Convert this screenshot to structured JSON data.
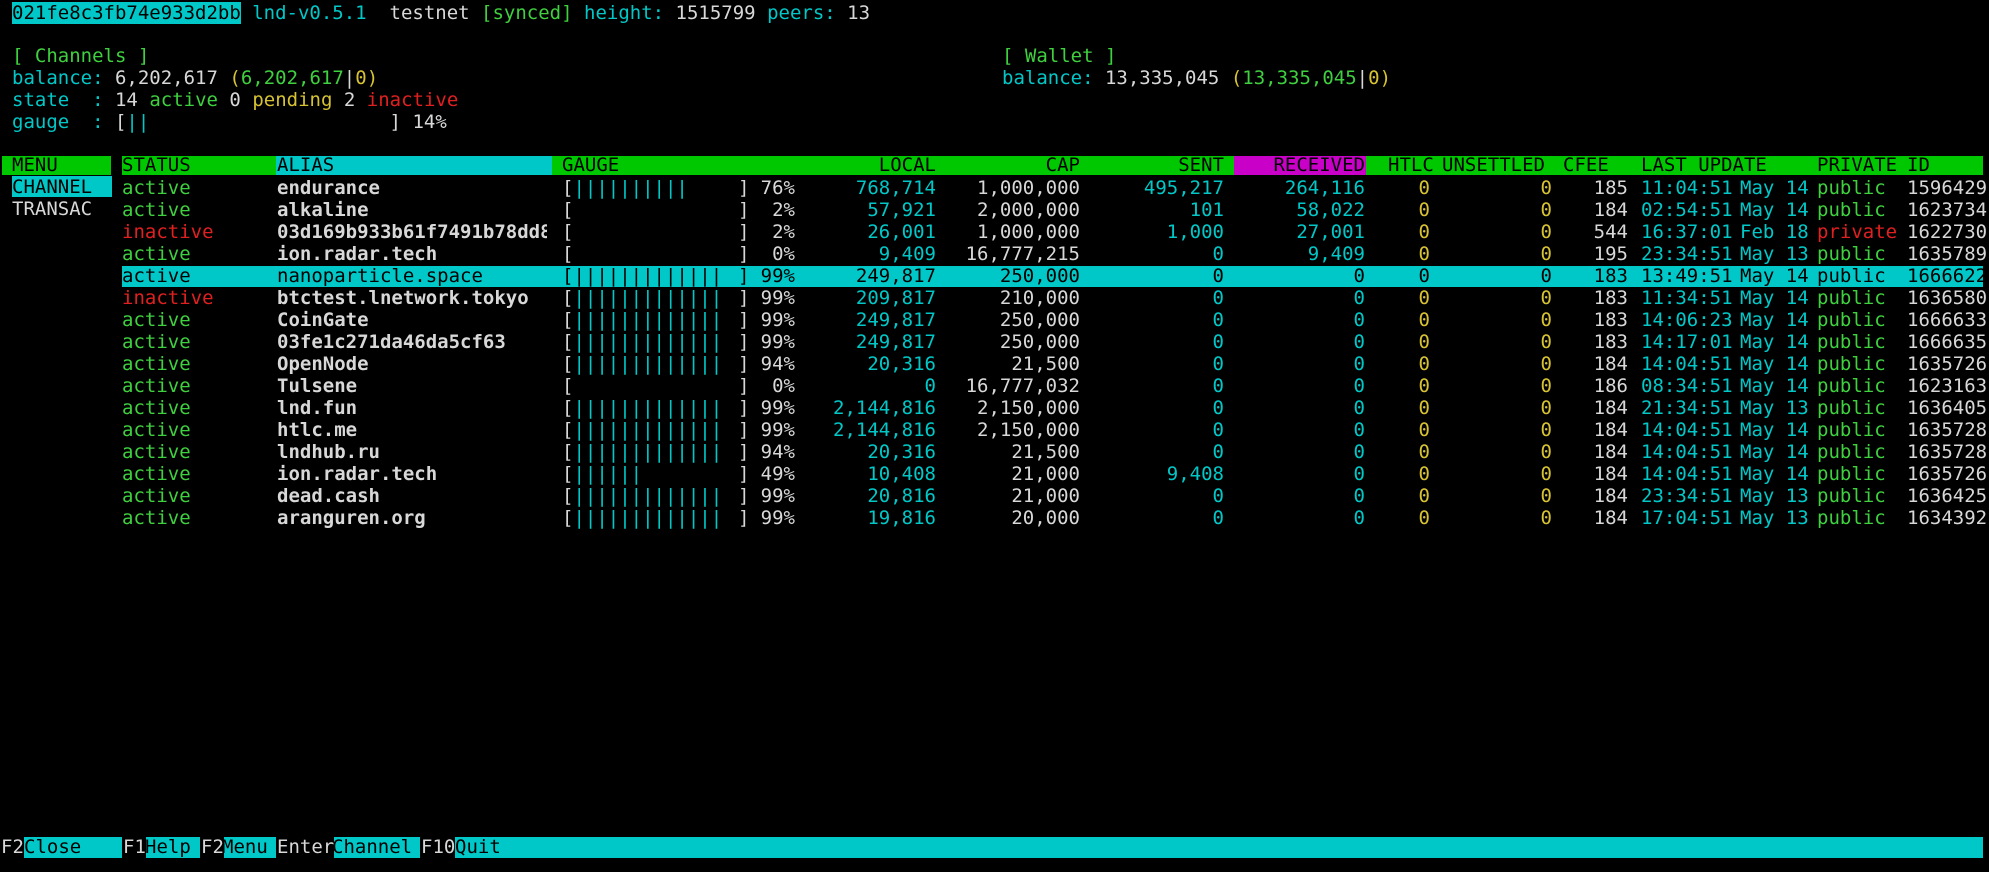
{
  "topbar": {
    "node_id": "021fe8c3fb74e933d2bb",
    "version": "lnd-v0.5.1",
    "network": "testnet",
    "sync_status": "[synced]",
    "height_label": "height:",
    "height": "1515799",
    "peers_label": "peers:",
    "peers": "13"
  },
  "channels_summary": {
    "title": "[ Channels ]",
    "balance_label": "balance:",
    "balance": "6,202,617",
    "balance_local": "6,202,617",
    "balance_remote": "0",
    "state_label": "state  :",
    "active_count": "14",
    "active_label": "active",
    "pending_count": "0",
    "pending_label": "pending",
    "inactive_count": "2",
    "inactive_label": "inactive",
    "gauge_label": "gauge  :",
    "gauge_fill": "||",
    "gauge_percent": "14%"
  },
  "wallet_summary": {
    "title": "[ Wallet ]",
    "balance_label": "balance:",
    "balance": "13,335,045",
    "balance_confirmed": "13,335,045",
    "balance_unconfirmed": "0"
  },
  "menu": {
    "header": "MENU",
    "items": [
      "CHANNEL",
      "TRANSAC"
    ]
  },
  "table": {
    "headers": {
      "status": "STATUS",
      "alias": "ALIAS",
      "gauge": "GAUGE",
      "local": "LOCAL",
      "cap": "CAP",
      "sent": "SENT",
      "received": "RECEIVED",
      "htlc": "HTLC",
      "unsettled": "UNSETTLED",
      "cfee": "CFEE",
      "last_update": "LAST UPDATE",
      "private": "PRIVATE",
      "id": "ID"
    },
    "selected_row": 4,
    "rows": [
      {
        "status": "active",
        "alias": "endurance",
        "gauge": "||||||||||",
        "pct": "76%",
        "local": "768,714",
        "cap": "1,000,000",
        "sent": "495,217",
        "received": "264,116",
        "htlc": "0",
        "unsettled": "0",
        "cfee": "185",
        "time": "11:04:51",
        "date": "May 14",
        "private": "public",
        "id": "1596429"
      },
      {
        "status": "active",
        "alias": "alkaline",
        "gauge": "",
        "pct": "2%",
        "local": "57,921",
        "cap": "2,000,000",
        "sent": "101",
        "received": "58,022",
        "htlc": "0",
        "unsettled": "0",
        "cfee": "184",
        "time": "02:54:51",
        "date": "May 14",
        "private": "public",
        "id": "1623734"
      },
      {
        "status": "inactive",
        "alias": "03d169b933b61f7491b78dd8",
        "gauge": "",
        "pct": "2%",
        "local": "26,001",
        "cap": "1,000,000",
        "sent": "1,000",
        "received": "27,001",
        "htlc": "0",
        "unsettled": "0",
        "cfee": "544",
        "time": "16:37:01",
        "date": "Feb 18",
        "private": "private",
        "id": "1622730"
      },
      {
        "status": "active",
        "alias": "ion.radar.tech",
        "gauge": "",
        "pct": "0%",
        "local": "9,409",
        "cap": "16,777,215",
        "sent": "0",
        "received": "9,409",
        "htlc": "0",
        "unsettled": "0",
        "cfee": "195",
        "time": "23:34:51",
        "date": "May 13",
        "private": "public",
        "id": "1635789"
      },
      {
        "status": "active",
        "alias": "nanoparticle.space",
        "gauge": "|||||||||||||",
        "pct": "99%",
        "local": "249,817",
        "cap": "250,000",
        "sent": "0",
        "received": "0",
        "htlc": "0",
        "unsettled": "0",
        "cfee": "183",
        "time": "13:49:51",
        "date": "May 14",
        "private": "public",
        "id": "1666622"
      },
      {
        "status": "inactive",
        "alias": "btctest.lnetwork.tokyo",
        "gauge": "|||||||||||||",
        "pct": "99%",
        "local": "209,817",
        "cap": "210,000",
        "sent": "0",
        "received": "0",
        "htlc": "0",
        "unsettled": "0",
        "cfee": "183",
        "time": "11:34:51",
        "date": "May 14",
        "private": "public",
        "id": "1636580"
      },
      {
        "status": "active",
        "alias": "CoinGate",
        "gauge": "|||||||||||||",
        "pct": "99%",
        "local": "249,817",
        "cap": "250,000",
        "sent": "0",
        "received": "0",
        "htlc": "0",
        "unsettled": "0",
        "cfee": "183",
        "time": "14:06:23",
        "date": "May 14",
        "private": "public",
        "id": "1666633"
      },
      {
        "status": "active",
        "alias": "03fe1c271da46da5cf63",
        "gauge": "|||||||||||||",
        "pct": "99%",
        "local": "249,817",
        "cap": "250,000",
        "sent": "0",
        "received": "0",
        "htlc": "0",
        "unsettled": "0",
        "cfee": "183",
        "time": "14:17:01",
        "date": "May 14",
        "private": "public",
        "id": "1666635"
      },
      {
        "status": "active",
        "alias": "OpenNode",
        "gauge": "|||||||||||||",
        "pct": "94%",
        "local": "20,316",
        "cap": "21,500",
        "sent": "0",
        "received": "0",
        "htlc": "0",
        "unsettled": "0",
        "cfee": "184",
        "time": "14:04:51",
        "date": "May 14",
        "private": "public",
        "id": "1635726"
      },
      {
        "status": "active",
        "alias": "Tulsene",
        "gauge": "",
        "pct": "0%",
        "local": "0",
        "cap": "16,777,032",
        "sent": "0",
        "received": "0",
        "htlc": "0",
        "unsettled": "0",
        "cfee": "186",
        "time": "08:34:51",
        "date": "May 14",
        "private": "public",
        "id": "1623163"
      },
      {
        "status": "active",
        "alias": "lnd.fun",
        "gauge": "|||||||||||||",
        "pct": "99%",
        "local": "2,144,816",
        "cap": "2,150,000",
        "sent": "0",
        "received": "0",
        "htlc": "0",
        "unsettled": "0",
        "cfee": "184",
        "time": "21:34:51",
        "date": "May 13",
        "private": "public",
        "id": "1636405"
      },
      {
        "status": "active",
        "alias": "htlc.me",
        "gauge": "|||||||||||||",
        "pct": "99%",
        "local": "2,144,816",
        "cap": "2,150,000",
        "sent": "0",
        "received": "0",
        "htlc": "0",
        "unsettled": "0",
        "cfee": "184",
        "time": "14:04:51",
        "date": "May 14",
        "private": "public",
        "id": "1635728"
      },
      {
        "status": "active",
        "alias": "lndhub.ru",
        "gauge": "|||||||||||||",
        "pct": "94%",
        "local": "20,316",
        "cap": "21,500",
        "sent": "0",
        "received": "0",
        "htlc": "0",
        "unsettled": "0",
        "cfee": "184",
        "time": "14:04:51",
        "date": "May 14",
        "private": "public",
        "id": "1635728"
      },
      {
        "status": "active",
        "alias": "ion.radar.tech",
        "gauge": "||||||",
        "pct": "49%",
        "local": "10,408",
        "cap": "21,000",
        "sent": "9,408",
        "received": "0",
        "htlc": "0",
        "unsettled": "0",
        "cfee": "184",
        "time": "14:04:51",
        "date": "May 14",
        "private": "public",
        "id": "1635726"
      },
      {
        "status": "active",
        "alias": "dead.cash",
        "gauge": "|||||||||||||",
        "pct": "99%",
        "local": "20,816",
        "cap": "21,000",
        "sent": "0",
        "received": "0",
        "htlc": "0",
        "unsettled": "0",
        "cfee": "184",
        "time": "23:34:51",
        "date": "May 13",
        "private": "public",
        "id": "1636425"
      },
      {
        "status": "active",
        "alias": "aranguren.org",
        "gauge": "|||||||||||||",
        "pct": "99%",
        "local": "19,816",
        "cap": "20,000",
        "sent": "0",
        "received": "0",
        "htlc": "0",
        "unsettled": "0",
        "cfee": "184",
        "time": "17:04:51",
        "date": "May 13",
        "private": "public",
        "id": "1634392"
      }
    ]
  },
  "bottom_bar": {
    "keys": [
      {
        "key": "F2",
        "label": "Close"
      },
      {
        "key": "F1",
        "label": "Help"
      },
      {
        "key": "F2",
        "label": "Menu"
      },
      {
        "key": "Enter",
        "label": "Channel"
      },
      {
        "key": "F10",
        "label": "Quit"
      }
    ]
  },
  "colors": {
    "header_bg": "#00c800",
    "cyan": "#00c8c8",
    "received_header_bg": "#c800c8",
    "active": "#3fd03f",
    "inactive": "#e02020",
    "yellow": "#d6c232"
  }
}
